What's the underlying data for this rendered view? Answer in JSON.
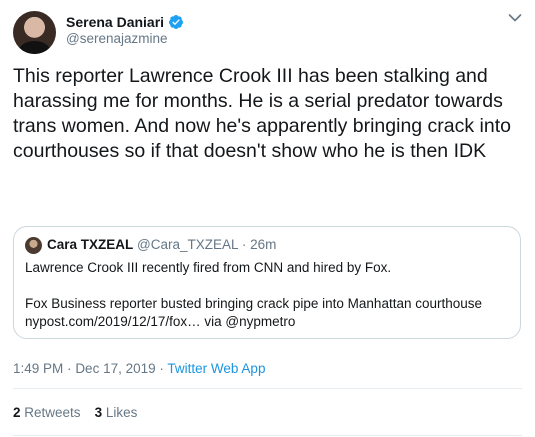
{
  "author": {
    "display_name": "Serena Daniari",
    "handle": "@serenajazmine",
    "verified": true
  },
  "tweet_text": "This reporter Lawrence Crook III has been stalking and harassing me for months. He is a serial predator towards trans women. And now he's apparently bringing crack into courthouses so if that doesn't show who he is then IDK",
  "quoted_tweet": {
    "display_name": "Cara TXZEAL",
    "handle": "@Cara_TXZEAL",
    "separator": "·",
    "age": "26m",
    "line1": "Lawrence Crook III recently fired from CNN and hired by Fox.",
    "line2": "Fox Business reporter busted bringing crack pipe into Manhattan courthouse",
    "line3": "nypost.com/2019/12/17/fox… via @nypmetro"
  },
  "meta": {
    "time": "1:49 PM",
    "separator1": "·",
    "date": "Dec 17, 2019",
    "separator2": "·",
    "source": "Twitter Web App"
  },
  "stats": {
    "retweets_count": "2",
    "retweets_label": "Retweets",
    "likes_count": "3",
    "likes_label": "Likes"
  },
  "colors": {
    "link": "#1b95e0",
    "secondary_text": "#657786",
    "border": "#ccd6dd",
    "verified_badge": "#1da1f2"
  },
  "icons": [
    "verified-badge-icon",
    "chevron-down-icon"
  ]
}
